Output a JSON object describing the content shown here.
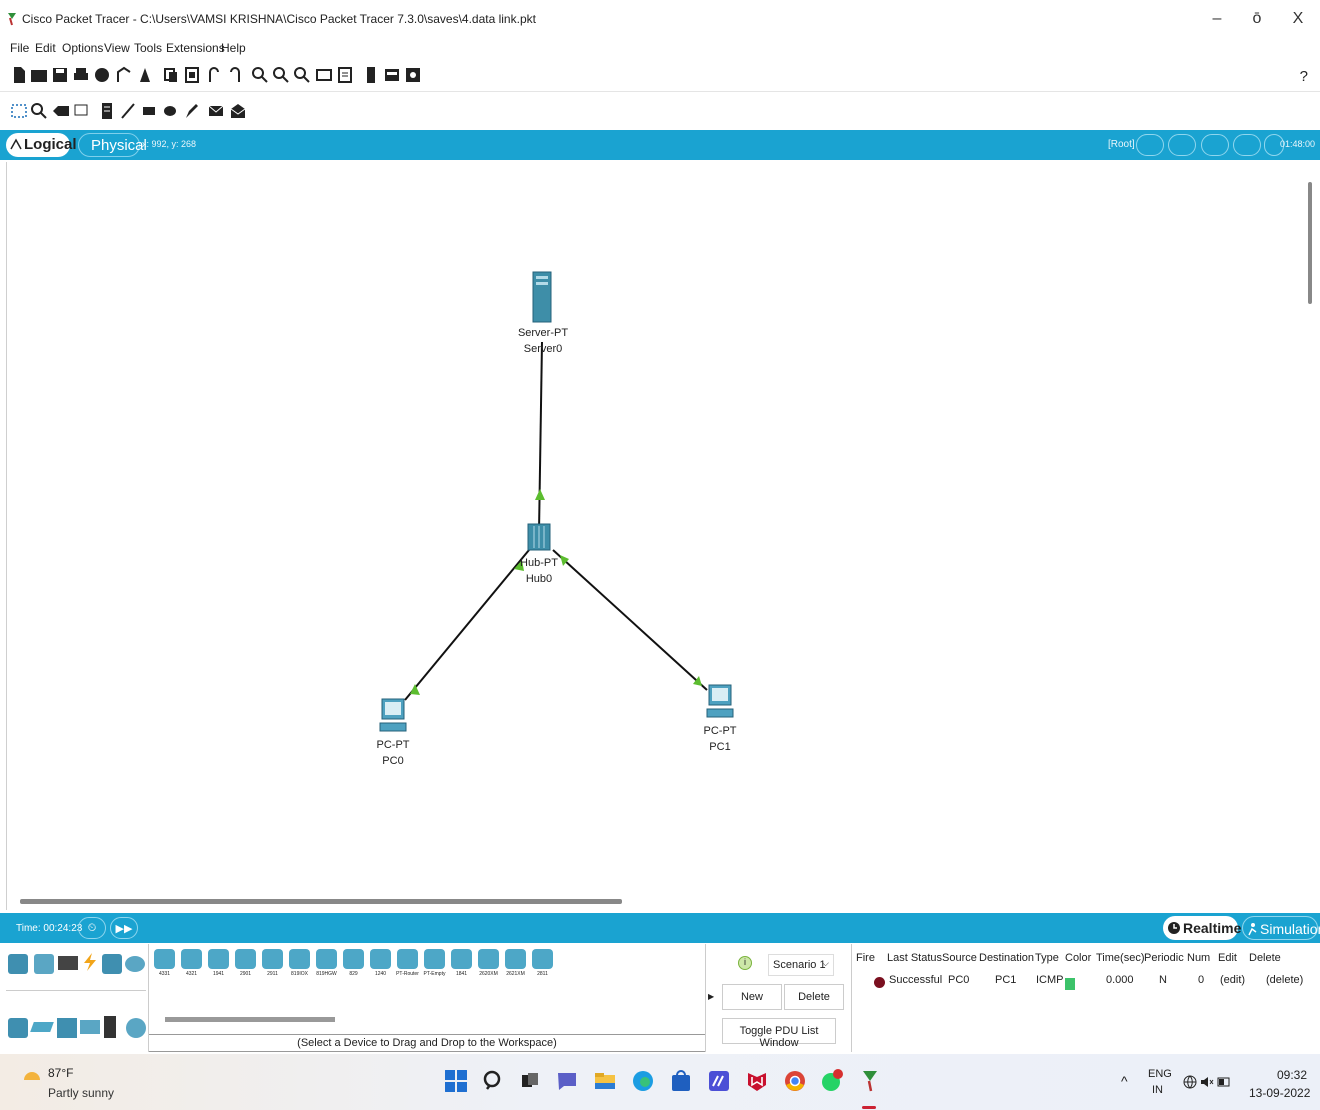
{
  "window": {
    "title": "Cisco Packet Tracer - C:\\Users\\VAMSI KRISHNA\\Cisco Packet Tracer 7.3.0\\saves\\4.data link.pkt",
    "minimize": "–",
    "maximize": "ō",
    "close": "X"
  },
  "menu": [
    "File",
    "Edit",
    "Options",
    "View",
    "Tools",
    "Extensions",
    "Help"
  ],
  "toolbar": {
    "help": "?"
  },
  "mode": {
    "logical": "Logical",
    "physical": "Physical",
    "coords": "x: 992, y: 268",
    "root": "[Root]",
    "clock": "01:48:00"
  },
  "devices": {
    "server": {
      "type": "Server-PT",
      "name": "Server0"
    },
    "hub": {
      "type": "Hub-PT",
      "name": "Hub0"
    },
    "pc0": {
      "type": "PC-PT",
      "name": "PC0"
    },
    "pc1": {
      "type": "PC-PT",
      "name": "PC1"
    }
  },
  "sim": {
    "time": "Time: 00:24:23",
    "realtime": "Realtime",
    "simulation": "Simulation"
  },
  "models": [
    "4331",
    "4321",
    "1941",
    "2901",
    "2911",
    "819IOX",
    "819HGW",
    "829",
    "1240",
    "PT-Router",
    "PT-Empty",
    "1841",
    "2620XM",
    "2621XM",
    "2811"
  ],
  "device_hint": "(Select a Device to Drag and Drop to the Workspace)",
  "pdu": {
    "scenario": "Scenario 1",
    "new": "New",
    "delete": "Delete",
    "toggle": "Toggle PDU List Window",
    "headers": [
      "Fire",
      "Last Status",
      "Source",
      "Destination",
      "Type",
      "Color",
      "Time(sec)",
      "Periodic",
      "Num",
      "Edit",
      "Delete"
    ],
    "row": {
      "status": "Successful",
      "source": "PC0",
      "destination": "PC1",
      "type": "ICMP",
      "color": "#3cc36a",
      "time": "0.000",
      "periodic": "N",
      "num": "0",
      "edit": "(edit)",
      "delete": "(delete)"
    }
  },
  "taskbar": {
    "temp": "87°F",
    "weather": "Partly sunny",
    "lang": "ENG",
    "region": "IN",
    "time": "09:32",
    "date": "13-09-2022"
  }
}
